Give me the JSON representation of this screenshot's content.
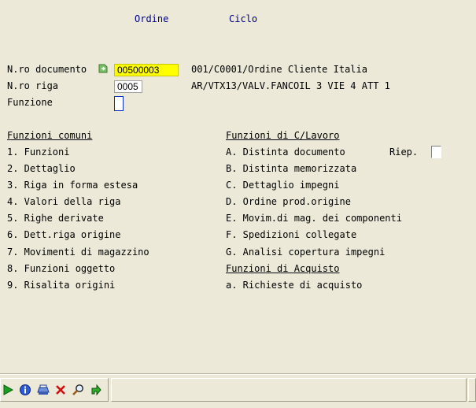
{
  "header": {
    "ordine": "Ordine",
    "ciclo": "Ciclo"
  },
  "form": {
    "documento_label": "N.ro documento",
    "documento_value": "00500003",
    "documento_desc": "001/C0001/Ordine Cliente Italia",
    "riga_label": "N.ro riga",
    "riga_value": "0005",
    "riga_desc": "AR/VTX13/VALV.FANCOIL 3 VIE 4 ATT 1",
    "funzione_label": "Funzione",
    "funzione_value": ""
  },
  "left": {
    "title": "Funzioni comuni",
    "items": [
      "1. Funzioni",
      "2. Dettaglio",
      "3. Riga in forma estesa",
      "4. Valori della riga",
      "5. Righe derivate",
      "6. Dett.riga origine",
      "7. Movimenti di magazzino",
      "8. Funzioni oggetto",
      "9. Risalita origini"
    ]
  },
  "right": {
    "title": "Funzioni di C/Lavoro",
    "items": [
      "A. Distinta documento",
      "B. Distinta memorizzata",
      "C. Dettaglio impegni",
      "D. Ordine prod.origine",
      "E. Movim.di mag. dei componenti",
      "F. Spedizioni collegate",
      "G. Analisi copertura impegni"
    ],
    "riep_label": "Riep.",
    "acquisto_title": "Funzioni di Acquisto",
    "acquisto_items": [
      "a. Richieste di acquisto"
    ]
  },
  "toolbar": {
    "icons": [
      "run-icon",
      "info-icon",
      "print-icon",
      "delete-icon",
      "zoom-icon",
      "exit-icon"
    ]
  }
}
